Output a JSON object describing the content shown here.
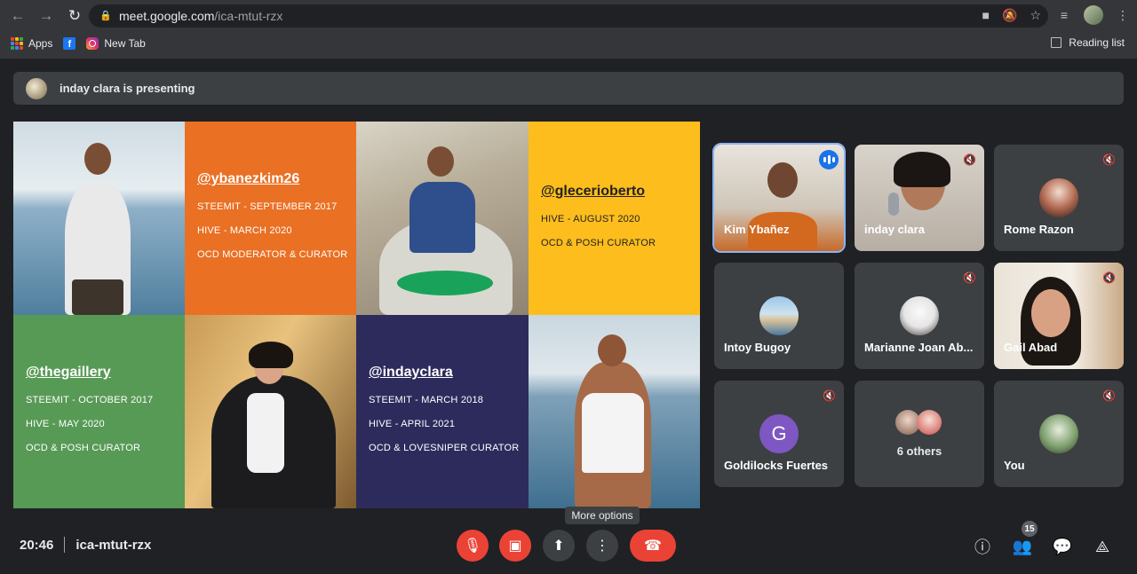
{
  "browser": {
    "url_host": "meet.google.com",
    "url_path": "/ica-mtut-rzx",
    "bookmarks": [
      {
        "label": "Apps"
      },
      {
        "label": ""
      },
      {
        "label": "New Tab"
      }
    ],
    "reading_list_label": "Reading list"
  },
  "meet": {
    "presenting_text": "inday clara is presenting",
    "slide": {
      "cards": [
        {
          "handle": "@ybanezkim26",
          "lines": [
            "STEEMIT - SEPTEMBER 2017",
            "HIVE - MARCH 2020",
            "OCD MODERATOR & CURATOR"
          ]
        },
        {
          "handle": "@glecerioberto",
          "lines": [
            "HIVE - AUGUST 2020",
            "OCD & POSH CURATOR"
          ]
        },
        {
          "handle": "@thegaillery",
          "lines": [
            "STEEMIT - OCTOBER 2017",
            "HIVE - MAY 2020",
            "OCD & POSH CURATOR"
          ]
        },
        {
          "handle": "@indayclara",
          "lines": [
            "STEEMIT - MARCH 2018",
            "HIVE - APRIL 2021",
            "OCD & LOVESNIPER CURATOR"
          ]
        }
      ]
    },
    "participants": [
      {
        "name": "Kim Ybañez"
      },
      {
        "name": "inday clara"
      },
      {
        "name": "Rome Razon"
      },
      {
        "name": "Intoy Bugoy"
      },
      {
        "name": "Marianne Joan Ab..."
      },
      {
        "name": "Gail Abad"
      },
      {
        "name": "Goldilocks Fuertes",
        "initial": "G"
      },
      {
        "name": "6 others"
      },
      {
        "name": "You"
      }
    ],
    "bottom": {
      "time": "20:46",
      "meeting_code": "ica-mtut-rzx",
      "tooltip": "More options",
      "participant_count": "15"
    }
  }
}
